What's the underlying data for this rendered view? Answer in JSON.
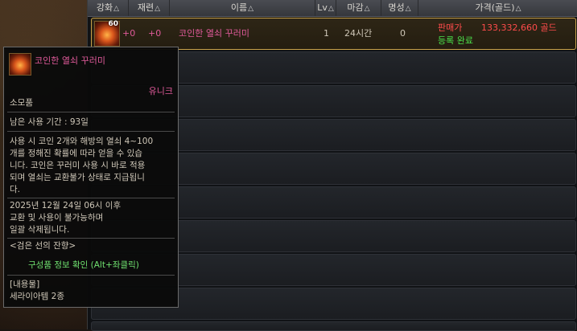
{
  "headers": {
    "enhance": "강화",
    "refine": "재련",
    "name": "이름",
    "level": "Lv",
    "deadline": "마감",
    "fame": "명성",
    "price": "가격(골드)"
  },
  "item": {
    "level_badge": "60",
    "enhance": "+0",
    "refine": "+0",
    "name": "코인한 열쇠 꾸러미",
    "level": "1",
    "deadline": "24시간",
    "fame": "0",
    "sell_label": "판매가",
    "sell_price": "133,332,660 골드",
    "status": "등록 완료"
  },
  "tooltip": {
    "name": "코인한 열쇠 꾸러미",
    "rarity": "유니크",
    "category": "소모품",
    "remaining": "남은 사용 기간 : 93일",
    "desc1": "사용 시 코인 2개와 해방의 열쇠 4~100",
    "desc2": "개를 정해진 확률에 따라 얻을 수 있습",
    "desc3": "니다. 코인은 꾸러미 사용 시 바로 적용",
    "desc4": "되며 열쇠는 교환불가 상태로 지급됩니",
    "desc5": "다.",
    "expire1": "2025년 12월 24일 06시 이후",
    "expire2": "교환 및 사용이 불가능하며",
    "expire3": "일괄 삭제됩니다.",
    "set_name": "<검은 선의 잔향>",
    "component": "구성품 정보 확인 (Alt+좌클릭)",
    "contents_label": "[내용물]",
    "contents": "세라이아템 2종"
  },
  "colors": {
    "rarity": "#e05a9a",
    "price": "#ff4b4b",
    "status": "#4be04b",
    "selected_border": "#c9a24a"
  }
}
